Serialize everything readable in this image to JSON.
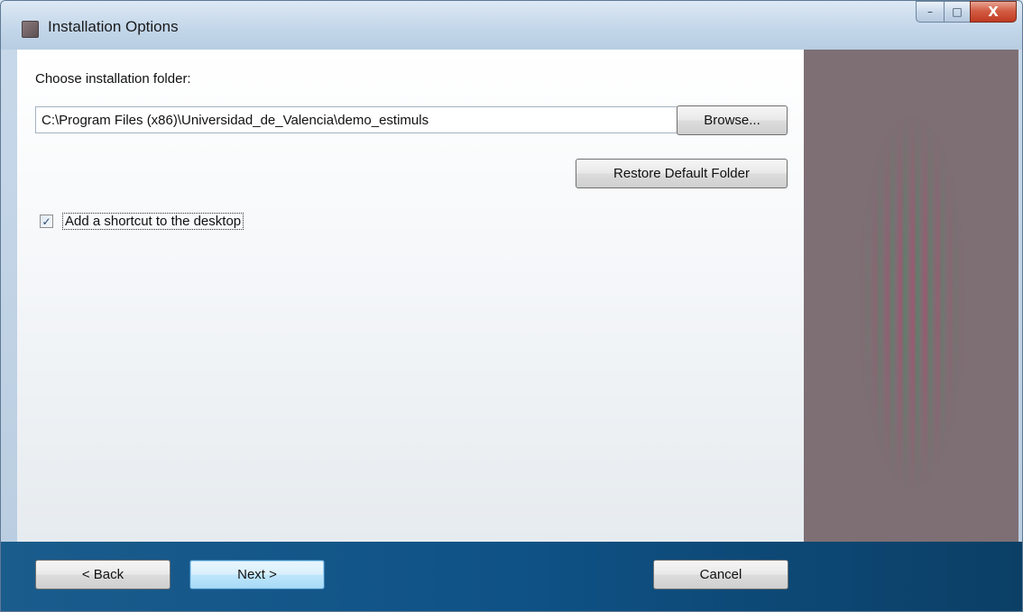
{
  "window": {
    "title": "Installation Options",
    "controls": {
      "minimize": "–",
      "maximize": "□",
      "close": "X"
    }
  },
  "main": {
    "folder_label": "Choose installation folder:",
    "folder_value": "C:\\Program Files (x86)\\Universidad_de_Valencia\\demo_estimuls",
    "browse_label": "Browse...",
    "restore_label": "Restore Default Folder",
    "shortcut_checked": true,
    "shortcut_check_glyph": "✓",
    "shortcut_label": "Add a shortcut to the desktop"
  },
  "footer": {
    "back_label": "< Back",
    "next_label": "Next >",
    "cancel_label": "Cancel"
  },
  "colors": {
    "footer_bar": "#0f5286",
    "side_panel": "#7d6f74",
    "default_button": "#a7d9f5"
  }
}
